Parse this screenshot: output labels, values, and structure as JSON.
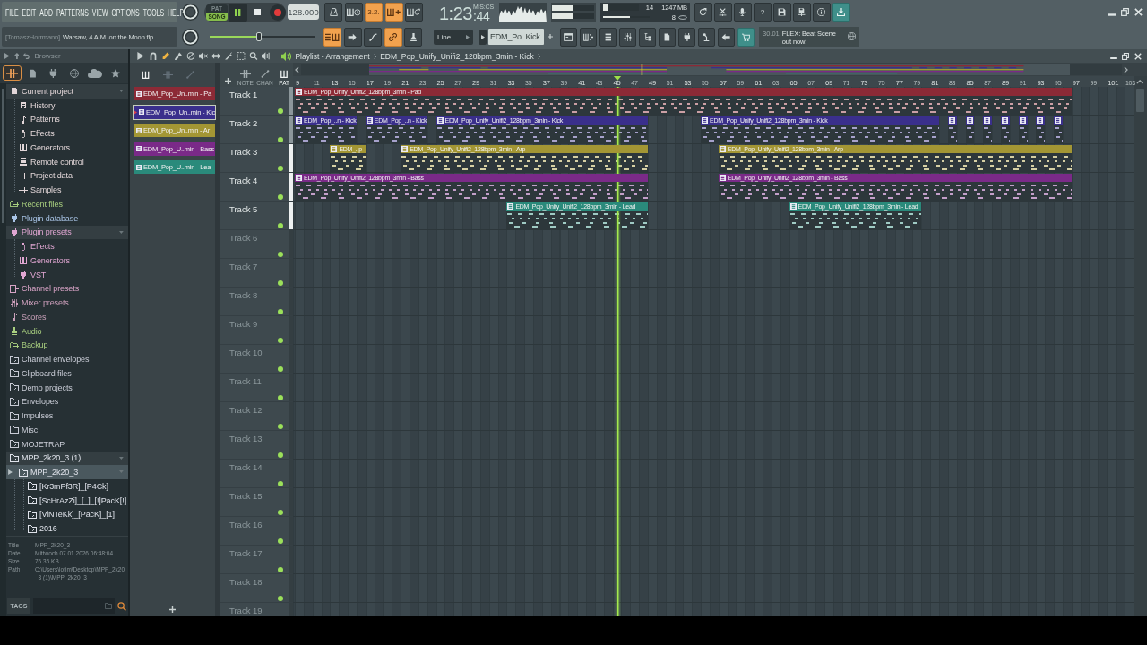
{
  "menu": [
    "FILE",
    "EDIT",
    "ADD",
    "PATTERNS",
    "VIEW",
    "OPTIONS",
    "TOOLS",
    "HELP"
  ],
  "hint_bar": {
    "user": "[TomaszHorrmann]",
    "file": "Warsaw, 4 A.M. on the Moon.flp"
  },
  "transport": {
    "modes": [
      {
        "label": "PAT",
        "selected": false
      },
      {
        "label": "SONG",
        "selected": true
      }
    ],
    "playing": true,
    "tempo": "128.000"
  },
  "song_position": {
    "level": 0.47
  },
  "record_toggles": [
    {
      "kind": "metronome",
      "on": false
    },
    {
      "kind": "wait",
      "on": false
    },
    {
      "kind": "countdown",
      "label": "3.2.",
      "on": true
    },
    {
      "kind": "blend",
      "on": true
    },
    {
      "kind": "loop",
      "on": false
    }
  ],
  "edit_toggles": [
    {
      "kind": "typing",
      "on": true
    },
    {
      "kind": "step",
      "on": false
    },
    {
      "kind": "curve",
      "on": false
    },
    {
      "kind": "link",
      "on": true
    },
    {
      "kind": "stamp",
      "on": false
    }
  ],
  "time": {
    "value": "1:23",
    "hundredths": ":44",
    "unit": "M:S:CS"
  },
  "output_meters": [
    {
      "level": 0.52
    },
    {
      "level": 0.52
    }
  ],
  "monitor": {
    "cpu": "14",
    "memory": "1247 MB",
    "polyphony": "8",
    "cpu_meter": {
      "level": 0.14
    },
    "memory_meter": {
      "level": 0.58
    }
  },
  "app_buttons": [
    {
      "kind": "refresh",
      "highlighted": false
    },
    {
      "kind": "cross",
      "highlighted": false
    },
    {
      "kind": "mic",
      "highlighted": false
    },
    {
      "kind": "help",
      "label": "?",
      "highlighted": false
    },
    {
      "kind": "save",
      "highlighted": false
    },
    {
      "kind": "saveas",
      "highlighted": false
    },
    {
      "kind": "info",
      "highlighted": false
    },
    {
      "kind": "download",
      "highlighted": true
    }
  ],
  "snap": {
    "value": "Line"
  },
  "pattern_selector": {
    "value": "EDM_Po..Kick"
  },
  "window_buttons": [
    {
      "kind": "playlist",
      "highlighted": false
    },
    {
      "kind": "pianoroll",
      "highlighted": false
    },
    {
      "kind": "channelrack",
      "highlighted": false
    },
    {
      "kind": "mixer",
      "highlighted": false
    },
    {
      "kind": "browser",
      "highlighted": false
    },
    {
      "kind": "document",
      "highlighted": false
    },
    {
      "kind": "plugin",
      "highlighted": false
    },
    {
      "kind": "touch",
      "highlighted": false
    },
    {
      "kind": "hand",
      "highlighted": false
    },
    {
      "kind": "shop",
      "highlighted": true
    }
  ],
  "news": {
    "date": "30.01",
    "text": "FLEX: Beat Scene out now!"
  },
  "browser": {
    "title": "Browser",
    "tabs": [
      {
        "kind": "all",
        "selected": true
      },
      {
        "kind": "project",
        "selected": false
      },
      {
        "kind": "plugins",
        "selected": false
      },
      {
        "kind": "online",
        "selected": false
      },
      {
        "kind": "cloud",
        "selected": false
      },
      {
        "kind": "favorites",
        "selected": false
      }
    ],
    "tree": [
      {
        "label": "Current project",
        "kind": "project",
        "color": "#e2d6d8",
        "expanded": true,
        "selected": false,
        "children": [
          {
            "label": "History",
            "kind": "history",
            "selected": false
          },
          {
            "label": "Patterns",
            "kind": "note",
            "selected": false
          },
          {
            "label": "Effects",
            "kind": "effect",
            "selected": false
          },
          {
            "label": "Generators",
            "kind": "keys",
            "selected": false
          },
          {
            "label": "Remote control",
            "kind": "remote",
            "selected": false
          },
          {
            "label": "Project data",
            "kind": "data",
            "selected": false
          },
          {
            "label": "Samples",
            "kind": "data",
            "selected": false
          }
        ]
      },
      {
        "label": "Recent files",
        "kind": "recent",
        "color": "#a9cf7f",
        "expanded": false,
        "selected": false
      },
      {
        "label": "Plugin database",
        "kind": "plugin",
        "color": "#a9c4e6",
        "expanded": false,
        "selected": false
      },
      {
        "label": "Plugin presets",
        "kind": "plugin",
        "color": "#e0a6d2",
        "expanded": true,
        "selected": false,
        "children": [
          {
            "label": "Effects",
            "kind": "effect",
            "selected": false
          },
          {
            "label": "Generators",
            "kind": "keys",
            "selected": false
          },
          {
            "label": "VST",
            "kind": "plugin",
            "selected": false
          }
        ]
      },
      {
        "label": "Channel presets",
        "kind": "channel",
        "color": "#d8a3c6",
        "expanded": false,
        "selected": false
      },
      {
        "label": "Mixer presets",
        "kind": "mixer",
        "color": "#cfa0bd",
        "expanded": false,
        "selected": false
      },
      {
        "label": "Scores",
        "kind": "note",
        "color": "#c9a0b9",
        "expanded": false,
        "selected": false
      },
      {
        "label": "Audio",
        "kind": "stamp",
        "color": "#a9cf7f",
        "expanded": false,
        "selected": false
      },
      {
        "label": "Backup",
        "kind": "recent",
        "color": "#a9cf7f",
        "expanded": false,
        "selected": false
      },
      {
        "label": "Channel envelopes",
        "kind": "folder",
        "color": "#c9ccd6",
        "expanded": false,
        "selected": false
      },
      {
        "label": "Clipboard files",
        "kind": "folder",
        "color": "#c9ccd6",
        "expanded": false,
        "selected": false
      },
      {
        "label": "Demo projects",
        "kind": "folder",
        "color": "#c9ccd6",
        "expanded": false,
        "selected": false
      },
      {
        "label": "Envelopes",
        "kind": "folder",
        "color": "#c9ccd6",
        "expanded": false,
        "selected": false
      },
      {
        "label": "Impulses",
        "kind": "folder",
        "color": "#c9ccd6",
        "expanded": false,
        "selected": false
      },
      {
        "label": "Misc",
        "kind": "plainfolder",
        "color": "#c9ccd6",
        "expanded": false,
        "selected": false
      },
      {
        "label": "MOJETRAP",
        "kind": "folder",
        "color": "#c9ccd6",
        "expanded": false,
        "selected": false
      },
      {
        "label": "MPP_2k20_3 (1)",
        "kind": "folder",
        "color": "#dfe2ea",
        "expanded": true,
        "selected": false,
        "children": [
          {
            "label": "MPP_2k20_3",
            "kind": "folder",
            "expanded": true,
            "selected": true,
            "children": [
              {
                "label": "[Kr3mPf3R]_[P4Ck]",
                "kind": "folder",
                "selected": false
              },
              {
                "label": "[ScHrAzZi]_[_]_[!]PacK[!]",
                "kind": "folder",
                "selected": false
              },
              {
                "label": "[ViNTeKk]_[PacK]_[1]",
                "kind": "folder",
                "selected": false
              },
              {
                "label": "2016",
                "kind": "folder",
                "selected": false
              }
            ]
          }
        ]
      }
    ],
    "info": [
      {
        "key": "Title",
        "value": "MPP_2k20_3"
      },
      {
        "key": "Date",
        "value": "Mittwoch.07.01.2026 06:48:04"
      },
      {
        "key": "Size",
        "value": "76.36 KB"
      },
      {
        "key": "Path",
        "value": "C:\\Users\\lofim\\Desktop\\MPP_2k20_3 (1)\\MPP_2k20_3"
      }
    ],
    "tags_button": "TAGS"
  },
  "picker": {
    "filters": [
      {
        "kind": "keys",
        "selected": true
      },
      {
        "kind": "data",
        "selected": false
      },
      {
        "kind": "automation",
        "selected": false
      }
    ],
    "patterns": [
      {
        "label": "EDM_Pop_Un..min - Pa",
        "color": "#8c2a36",
        "selected": false
      },
      {
        "label": "EDM_Pop_Un..min - Kic",
        "color": "#3a2f8c",
        "selected": true
      },
      {
        "label": "EDM_Pop_Un..min - Ar",
        "color": "#a39634",
        "selected": false
      },
      {
        "label": "EDM_Pop_U..min - Bass",
        "color": "#7a2a88",
        "selected": false
      },
      {
        "label": "EDM_Pop_U..min - Lea",
        "color": "#2a8a7b",
        "selected": false
      }
    ]
  },
  "playlist": {
    "title": "Playlist - Arrangement",
    "pattern": "EDM_Pop_Unify_Unifi2_128bpm_3min - Kick",
    "tools": [
      {
        "kind": "menu",
        "selected": false
      },
      {
        "kind": "magnet",
        "selected": false
      },
      {
        "kind": "draw",
        "selected": true
      },
      {
        "kind": "paint",
        "selected": false
      },
      {
        "kind": "delete",
        "selected": false
      },
      {
        "kind": "mute",
        "selected": false
      },
      {
        "kind": "slip",
        "selected": false
      },
      {
        "kind": "slice",
        "selected": false
      },
      {
        "kind": "select",
        "selected": false
      },
      {
        "kind": "zoom",
        "selected": false
      },
      {
        "kind": "playback",
        "selected": false
      }
    ],
    "filters": [
      {
        "label": "NOTE",
        "kind": "data",
        "selected": false
      },
      {
        "label": "CHAN",
        "kind": "automation",
        "selected": false
      },
      {
        "label": "PAT",
        "kind": "keys",
        "selected": true
      }
    ],
    "ruler": [
      "9",
      "11",
      "13",
      "15",
      "17",
      "19",
      "21",
      "23",
      "25",
      "27",
      "29",
      "31",
      "33",
      "35",
      "37",
      "39",
      "41",
      "43",
      "45",
      "47",
      "49",
      "51",
      "53",
      "55",
      "57",
      "59",
      "61",
      "63",
      "65",
      "67",
      "69",
      "71",
      "73",
      "75",
      "77",
      "79",
      "81",
      "83",
      "85",
      "87",
      "89",
      "91",
      "93",
      "95",
      "97",
      "99",
      "101",
      "103"
    ],
    "tracks": [
      {
        "label": "Track 1",
        "enabled": true,
        "selected": false,
        "clips": [
          {
            "label": "EDM_Pop_Unify_Unifi2_128bpm_3min - Pad",
            "color": "#8c2a36"
          }
        ]
      },
      {
        "label": "Track 2",
        "enabled": true,
        "selected": false,
        "clips": [
          {
            "label": "EDM_Pop_..n - Kick",
            "color": "#3a2f8c"
          },
          {
            "label": "EDM_Pop_..n - Kick",
            "color": "#3a2f8c"
          },
          {
            "label": "EDM_Pop_Unify_Unifi2_128bpm_3min - Kick",
            "color": "#3a2f8c"
          },
          {
            "label": "EDM_Pop_Unify_Unifi2_128bpm_3min - Kick",
            "color": "#3a2f8c"
          },
          {
            "color": "#3a2f8c"
          },
          {
            "color": "#3a2f8c"
          },
          {
            "color": "#3a2f8c"
          },
          {
            "color": "#3a2f8c"
          },
          {
            "color": "#3a2f8c"
          },
          {
            "color": "#3a2f8c"
          },
          {
            "color": "#3a2f8c"
          }
        ]
      },
      {
        "label": "Track 3",
        "enabled": true,
        "selected": true,
        "clips": [
          {
            "label": "EDM_..p",
            "color": "#a39634"
          },
          {
            "label": "EDM_Pop_Unify_Unifi2_128bpm_3min - Arp",
            "color": "#a39634"
          },
          {
            "label": "EDM_Pop_Unify_Unifi2_128bpm_3min - Arp",
            "color": "#a39634"
          }
        ]
      },
      {
        "label": "Track 4",
        "enabled": true,
        "selected": true,
        "clips": [
          {
            "label": "EDM_Pop_Unify_Unifi2_128bpm_3min - Bass",
            "color": "#7a2a88"
          },
          {
            "label": "EDM_Pop_Unify_Unifi2_128bpm_3min - Bass",
            "color": "#7a2a88"
          }
        ]
      },
      {
        "label": "Track 5",
        "enabled": true,
        "selected": true,
        "clips": [
          {
            "label": "EDM_Pop_Unify_Unifi2_128bpm_3min - Lead",
            "color": "#2a8a7b"
          },
          {
            "label": "EDM_Pop_Unify_Unifi2_128bpm_3min - Lead",
            "color": "#2a8a7b"
          }
        ]
      },
      {
        "label": "Track 6",
        "enabled": true,
        "selected": false
      },
      {
        "label": "Track 7",
        "enabled": true,
        "selected": false
      },
      {
        "label": "Track 8",
        "enabled": true,
        "selected": false
      },
      {
        "label": "Track 9",
        "enabled": true,
        "selected": false
      },
      {
        "label": "Track 10",
        "enabled": true,
        "selected": false
      },
      {
        "label": "Track 11",
        "enabled": true,
        "selected": false
      },
      {
        "label": "Track 12",
        "enabled": true,
        "selected": false
      },
      {
        "label": "Track 13",
        "enabled": true,
        "selected": false
      },
      {
        "label": "Track 14",
        "enabled": true,
        "selected": false
      },
      {
        "label": "Track 15",
        "enabled": true,
        "selected": false
      },
      {
        "label": "Track 16",
        "enabled": true,
        "selected": false
      },
      {
        "label": "Track 17",
        "enabled": true,
        "selected": false
      },
      {
        "label": "Track 18",
        "enabled": true,
        "selected": false
      },
      {
        "label": "Track 19",
        "selected": false
      }
    ]
  }
}
